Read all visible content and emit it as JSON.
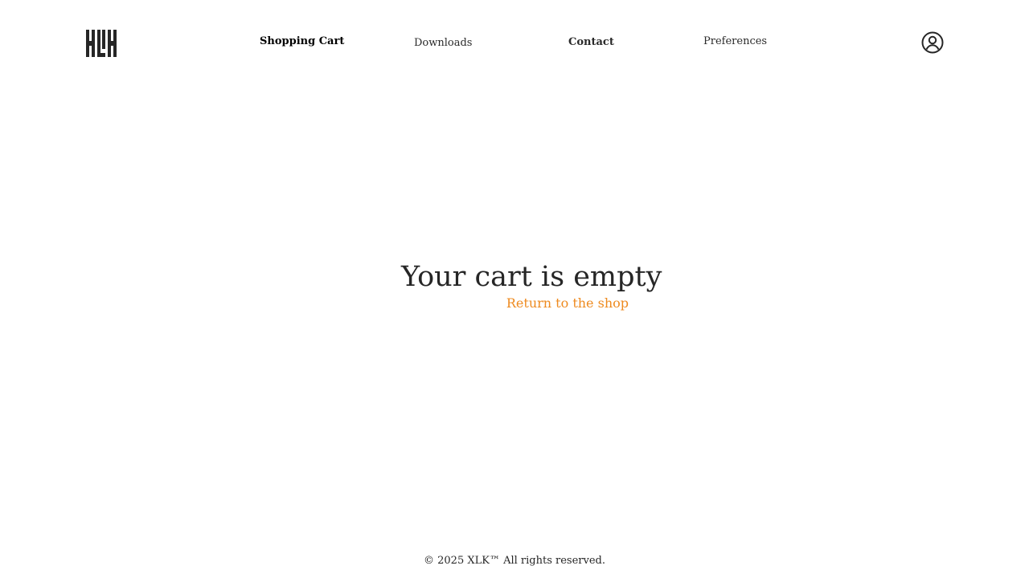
{
  "header": {
    "logo_text": "XLK",
    "nav": {
      "shopping_cart": "Shopping Cart",
      "downloads": "Downloads",
      "contact": "Contact",
      "preferences": "Preferences"
    },
    "account_icon": "user-circle-icon"
  },
  "main": {
    "empty_title": "Your cart is empty",
    "return_link": "Return to the shop"
  },
  "footer": {
    "copyright": "© 2025 XLK™ All rights reserved."
  },
  "colors": {
    "text": "#262626",
    "accent": "#ee8a1e",
    "background": "#ffffff"
  }
}
